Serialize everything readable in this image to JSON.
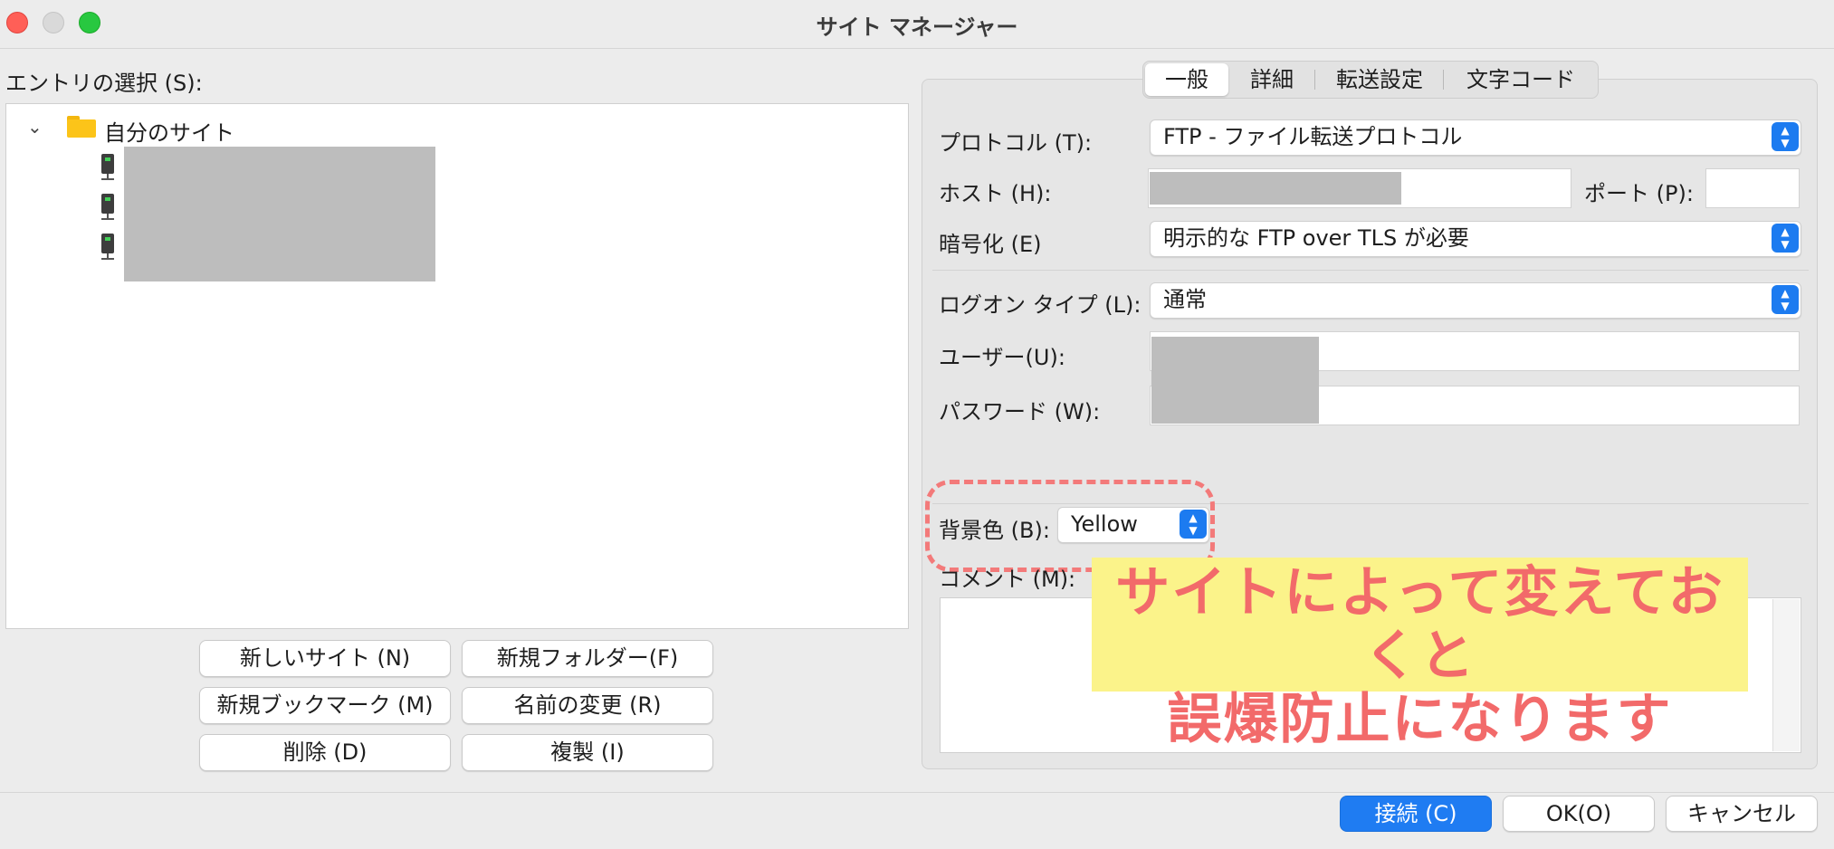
{
  "window": {
    "title": "サイト マネージャー"
  },
  "left": {
    "entry_label": "エントリの選択 (S):",
    "tree": {
      "root_label": "自分のサイト",
      "items": [
        {
          "icon": "server-icon"
        },
        {
          "icon": "server-icon"
        },
        {
          "icon": "server-icon"
        }
      ]
    },
    "buttons": {
      "new_site": "新しいサイト (N)",
      "new_folder": "新規フォルダー(F)",
      "new_bookmark": "新規ブックマーク (M)",
      "rename": "名前の変更 (R)",
      "delete": "削除 (D)",
      "duplicate": "複製 (I)"
    }
  },
  "right": {
    "tabs": [
      "一般",
      "詳細",
      "転送設定",
      "文字コード"
    ],
    "active_tab": "一般",
    "protocol_label": "プロトコル (T):",
    "protocol_value": "FTP - ファイル転送プロトコル",
    "host_label": "ホスト (H):",
    "port_label": "ポート (P):",
    "encryption_label": "暗号化 (E)",
    "encryption_value": "明示的な FTP over TLS が必要",
    "logon_label": "ログオン タイプ (L):",
    "logon_value": "通常",
    "user_label": "ユーザー(U):",
    "password_label": "パスワード (W):",
    "bgcolor_label": "背景色 (B):",
    "bgcolor_value": "Yellow",
    "comment_label": "コメント (M):",
    "annotation_line1": "サイトによって変えておくと",
    "annotation_line2": "誤爆防止になります"
  },
  "footer": {
    "connect": "接続 (C)",
    "ok": "OK(O)",
    "cancel": "キャンセル"
  },
  "colors": {
    "accent": "#1f7cf2",
    "annotation_bg": "#fbf38a",
    "annotation_text": "#f26a6a",
    "folder": "#fcc419"
  }
}
